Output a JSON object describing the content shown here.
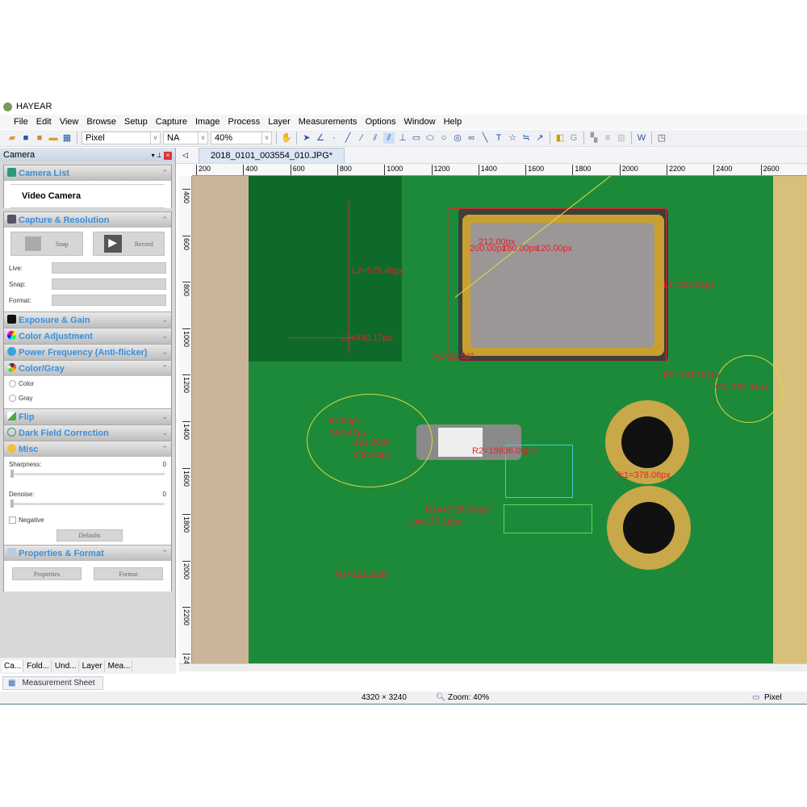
{
  "app": {
    "title": "HAYEAR"
  },
  "menu": [
    "File",
    "Edit",
    "View",
    "Browse",
    "Setup",
    "Capture",
    "Image",
    "Process",
    "Layer",
    "Measurements",
    "Options",
    "Window",
    "Help"
  ],
  "toolbar": {
    "unit": "Pixel",
    "magnification": "NA",
    "zoom": "40%",
    "icons": [
      "open-icon",
      "save-icon",
      "save-as-icon",
      "folder-icon",
      "grid-icon",
      "hand-icon",
      "pointer-icon",
      "angle-icon",
      "point-icon",
      "line-icon",
      "polyline-icon",
      "parallel-icon",
      "double-parallel-icon",
      "perpendicular-icon",
      "rectangle-icon",
      "ellipse-icon",
      "circle-icon",
      "concentric-icon",
      "link-icon",
      "arc-icon",
      "text-icon",
      "star-icon",
      "scale-bar-icon",
      "arrow-icon",
      "calibrate-icon",
      "g-icon",
      "layer-icon",
      "align-icon",
      "table-icon",
      "word-export-icon",
      "window-icon"
    ]
  },
  "panel": {
    "title": "Camera",
    "camera_list": {
      "title": "Camera List",
      "item": "Video Camera"
    },
    "capture": {
      "title": "Capture & Resolution",
      "snap": "Snap",
      "record": "Record",
      "live_label": "Live:",
      "snap_label": "Snap:",
      "format_label": "Format:"
    },
    "exposure": "Exposure & Gain",
    "color_adj": "Color Adjustment",
    "power": "Power Frequency (Anti-flicker)",
    "color_gray": {
      "title": "Color/Gray",
      "color": "Color",
      "gray": "Gray"
    },
    "flip": "Flip",
    "dark_field": "Dark Field Correction",
    "misc": {
      "title": "Misc",
      "sharpness_label": "Sharpness:",
      "sharpness": "0",
      "sharpness_level": 0,
      "denoise_label": "Denoise:",
      "denoise": "0",
      "denoise_level": 0,
      "negative": "Negative",
      "defaults": "Defaults"
    },
    "properties": {
      "title": "Properties & Format",
      "properties": "Properties",
      "format": "Format"
    }
  },
  "bottom_tabs": [
    "Ca...",
    "Fold...",
    "Und...",
    "Layer",
    "Mea..."
  ],
  "measurement_sheet": "Measurement Sheet",
  "document": {
    "tab": "2018_0101_003554_010.JPG*"
  },
  "ruler": {
    "top": [
      "200",
      "400",
      "600",
      "800",
      "1000",
      "1200",
      "1400",
      "1600",
      "1800",
      "2000",
      "2200",
      "2400",
      "2600"
    ],
    "left": [
      "400",
      "600",
      "800",
      "1000",
      "1200",
      "1400",
      "1600",
      "1800",
      "2000",
      "2200",
      "2400"
    ]
  },
  "measurements": [
    "L2=575.46px",
    "L3=430.17px",
    "A1=56.53°",
    "212.00px",
    "200.00px",
    "180.00px",
    "120.00px",
    "L1=202.21px",
    "P2=1342.97px",
    "C1=257.44px",
    "Tc1=378.06px",
    "84.85px",
    "18A.67px",
    "122.20px",
    "48A.60px",
    "R2=19836.00px²",
    "R1=47250.00px²",
    "L4=177.18px",
    "P1=122.33px"
  ],
  "status": {
    "dimensions": "4320 × 3240",
    "zoom": "Zoom: 40%",
    "unit": "Pixel"
  },
  "colors": {
    "measure": "#e8202a",
    "accent": "#3a8fdc",
    "pcb": "#1d8a3a"
  }
}
